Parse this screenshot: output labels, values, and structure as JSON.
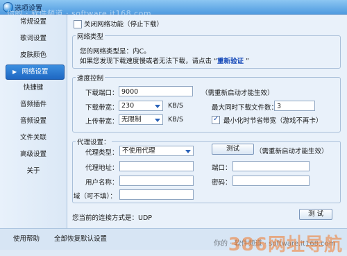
{
  "window": {
    "title": "选项设置",
    "watermark_top": "你的 · 软件频道 · software.it168.com"
  },
  "sidebar": {
    "items": [
      {
        "label": "常规设置"
      },
      {
        "label": "歌词设置"
      },
      {
        "label": "皮肤颜色"
      },
      {
        "label": "网络设置",
        "active": true
      },
      {
        "label": "快捷键"
      },
      {
        "label": "音频插件"
      },
      {
        "label": "音频设置"
      },
      {
        "label": "文件关联"
      },
      {
        "label": "高级设置"
      },
      {
        "label": "关于"
      }
    ]
  },
  "main": {
    "disable_network_label": "关闭网络功能（停止下载）",
    "network_type": {
      "title": "网络类型",
      "current_text": "您的网络类型是：内C。",
      "hint_text": "如果您发现下载速度慢或者无法下载，请点击 “",
      "revalidate_link": "重新验证",
      "hint_close": " ”"
    },
    "speed": {
      "title": "速度控制",
      "port_label": "下载端口：",
      "port_value": "9000",
      "restart_note": "（需重新启动才能生效）",
      "download_bw_label": "下载带宽：",
      "download_bw_value": "230",
      "download_unit": "KB/S",
      "upload_bw_label": "上传带宽：",
      "upload_bw_value": "无限制",
      "upload_unit": "KB/S",
      "max_files_label": "最大同时下载文件数：",
      "max_files_value": "3",
      "minimize_save_label": "最小化时节省带宽（游戏不再卡）",
      "minimize_save_checked": true
    },
    "proxy": {
      "title": "代理设置：",
      "type_label": "代理类型：",
      "type_value": "不使用代理",
      "test_button": "测试",
      "restart_note": "（需重新启动才能生效）",
      "address_label": "代理地址：",
      "port_label": "端口：",
      "user_label": "用户名称：",
      "password_label": "密码：",
      "domain_label": "域（可不填）："
    },
    "connection_text": "您当前的连接方式是：UDP",
    "test_button": "测 试"
  },
  "footer": {
    "help_button": "使用帮助",
    "restore_button": "全部恢复默认设置",
    "watermark_bottom": "你的 · 软件频道 · software.it168.com",
    "watermark_brand": "386网址导航"
  },
  "colors": {
    "active_item": "#1e67c2",
    "link": "#1448b8",
    "titlebar": "#4f9be0"
  }
}
